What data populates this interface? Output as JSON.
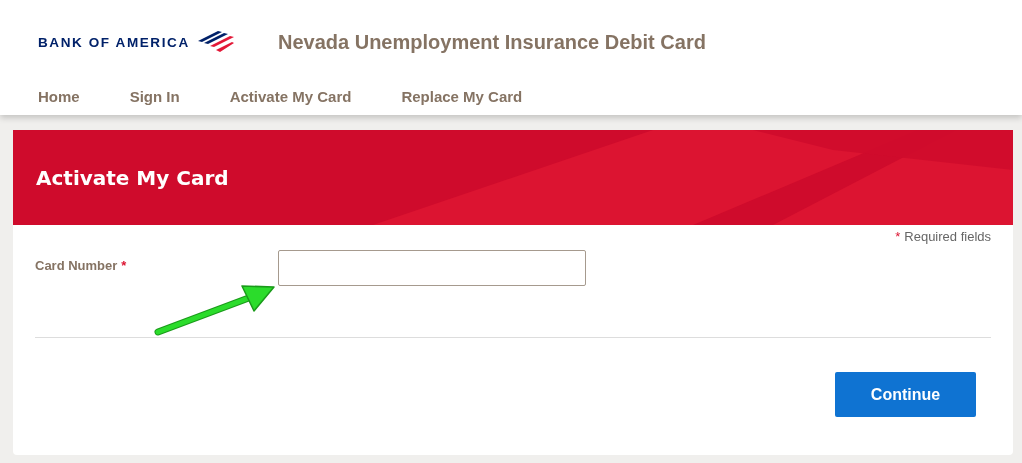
{
  "header": {
    "logo_text": "BANK OF AMERICA",
    "title": "Nevada Unemployment Insurance Debit Card"
  },
  "nav": [
    "Home",
    "Sign In",
    "Activate My Card",
    "Replace My Card"
  ],
  "banner": {
    "title": "Activate My Card"
  },
  "form": {
    "required_note": {
      "mark": "*",
      "text": "Required fields"
    },
    "fields": [
      {
        "label": "Card Number",
        "required_mark": "*"
      }
    ],
    "button": "Continue"
  }
}
